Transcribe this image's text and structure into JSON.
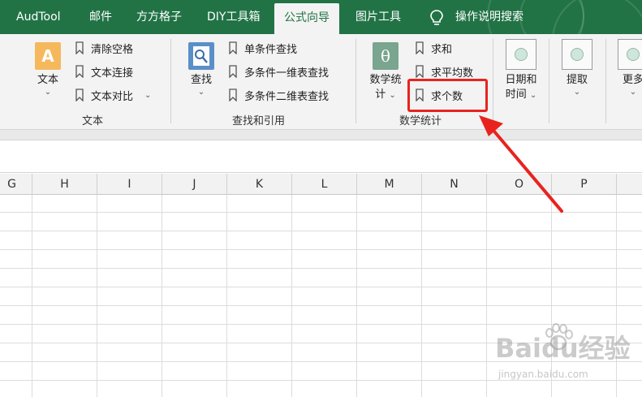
{
  "tabs": [
    "AudTool",
    "邮件",
    "方方格子",
    "DIY工具箱",
    "公式向导",
    "图片工具",
    "操作说明搜索"
  ],
  "active_tab": "公式向导",
  "colors": {
    "brand": "#217346",
    "highlight": "#e8231f"
  },
  "ribbon": {
    "text_group": {
      "label": "文本",
      "big_button": {
        "line1": "文本",
        "chevron": "⌄",
        "icon": "letter-a-icon"
      },
      "small_buttons": [
        "清除空格",
        "文本连接",
        "文本对比"
      ]
    },
    "lookup_group": {
      "label": "查找和引用",
      "big_button": {
        "line1": "查找",
        "chevron": "⌄",
        "icon": "magnifier-icon"
      },
      "small_buttons": [
        "单条件查找",
        "多条件一维表查找",
        "多条件二维表查找"
      ]
    },
    "math_group": {
      "label": "数学统计",
      "big_button": {
        "line1": "数学统",
        "line2": "计",
        "chevron": "⌄",
        "icon": "theta-icon"
      },
      "small_buttons": [
        "求和",
        "求平均数",
        "求个数"
      ]
    },
    "date_button": {
      "line1": "日期和",
      "line2": "时间",
      "chevron": "⌄"
    },
    "extract_button": {
      "line1": "提取",
      "chevron": "⌄"
    },
    "more_button": {
      "line1": "更多",
      "chevron": "⌄"
    }
  },
  "columns": [
    "G",
    "H",
    "I",
    "J",
    "K",
    "L",
    "M",
    "N",
    "O",
    "P"
  ],
  "watermark": {
    "brand": "Baidu经验",
    "url": "jingyan.baidu.com"
  }
}
